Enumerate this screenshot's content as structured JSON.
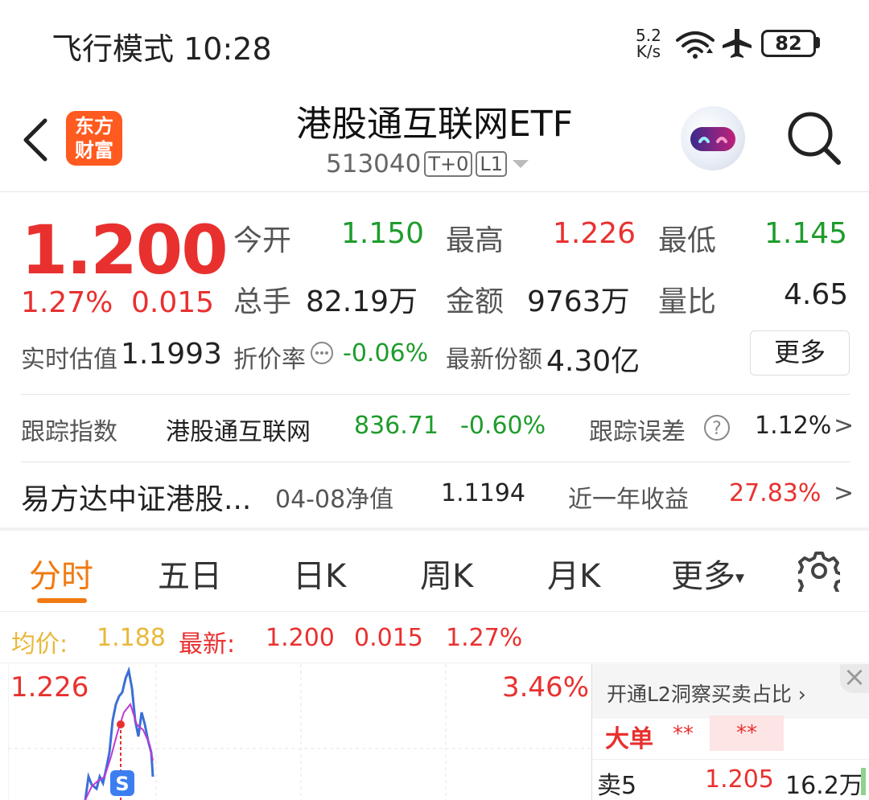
{
  "status_bar": {
    "mode": "飞行模式",
    "time": "10:28",
    "net_speed_value": "5.2",
    "net_speed_unit": "K/s",
    "battery": "82",
    "icons": [
      "wifi-icon",
      "airplane-icon",
      "battery-icon"
    ]
  },
  "header": {
    "logo_line1": "东方",
    "logo_line2": "财富",
    "title": "港股通互联网ETF",
    "code": "513040",
    "tag1": "T+0",
    "tag2": "L1"
  },
  "quote": {
    "price": "1.200",
    "change_pct": "1.27%",
    "change_abs": "0.015",
    "open_label": "今开",
    "open": "1.150",
    "high_label": "最高",
    "high": "1.226",
    "low_label": "最低",
    "low": "1.145",
    "volume_label": "总手",
    "volume": "82.19万",
    "amount_label": "金额",
    "amount": "9763万",
    "ratio_label": "量比",
    "ratio": "4.65",
    "iopv_label": "实时估值",
    "iopv": "1.1993",
    "discount_label": "折价率",
    "discount": "-0.06%",
    "shares_label": "最新份额",
    "shares": "4.30亿",
    "more_label": "更多"
  },
  "tracking": {
    "index_label": "跟踪指数",
    "index_name": "港股通互联网",
    "index_value": "836.71",
    "index_change": "-0.60%",
    "error_label": "跟踪误差",
    "error_value": "1.12%",
    "arrow": ">"
  },
  "fund": {
    "name": "易方达中证港股...",
    "nav_label": "04-08净值",
    "nav": "1.1194",
    "return_label": "近一年收益",
    "return_value": "27.83%",
    "arrow": ">"
  },
  "tabs": {
    "items": [
      "分时",
      "五日",
      "日K",
      "周K",
      "月K",
      "更多"
    ],
    "active": "分时",
    "more_caret": "▾"
  },
  "chart_info": {
    "avg_label": "均价:",
    "avg_value": "1.188",
    "latest_label": "最新:",
    "latest_price": "1.200",
    "latest_change": "0.015",
    "latest_pct": "1.27%",
    "y_max_label": "1.226",
    "pct_max_label": "3.46%",
    "marker": "S"
  },
  "l2_panel": {
    "promo": "开通L2洞察买卖占比",
    "promo_arrow": "›",
    "big_order_label": "大单",
    "masked1": "**",
    "masked2": "**",
    "sell5_label": "卖5",
    "sell5_price": "1.205",
    "sell5_volume": "16.2万"
  },
  "colors": {
    "up": "#e8312f",
    "down": "#1e9c2c",
    "accent": "#f07a12",
    "avg_line": "#e8b83a"
  }
}
